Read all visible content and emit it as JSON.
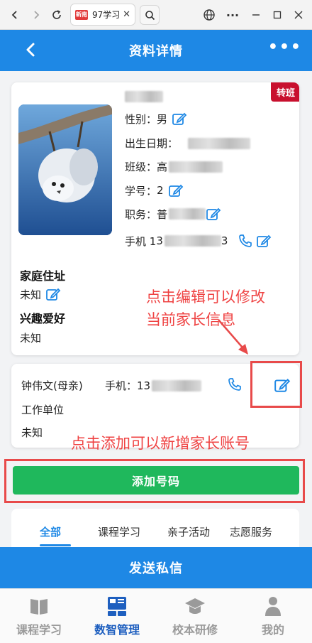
{
  "browser": {
    "tab_title": "97学习",
    "tab_favicon": "新南"
  },
  "header": {
    "title": "资料详情"
  },
  "profile": {
    "badge": "转班",
    "gender_label": "性别：",
    "gender_value": "男",
    "birthday_label": "出生日期：",
    "class_label": "班级：",
    "class_value_prefix": "高",
    "student_no_label": "学号：",
    "student_no_prefix": "2",
    "position_label": "职务：",
    "position_prefix": "普",
    "phone_label": "手机 1",
    "phone_prefix": "3",
    "phone_suffix": "3",
    "address_title": "家庭住址",
    "address_value": "未知",
    "hobby_title": "兴趣爱好",
    "hobby_value": "未知"
  },
  "parent": {
    "name": "钟伟文(母亲)",
    "phone_label": "手机：",
    "phone_prefix": "13",
    "work_title": "工作单位",
    "work_value": "未知"
  },
  "annotations": {
    "edit_hint_line1": "点击编辑可以修改",
    "edit_hint_line2": "当前家长信息",
    "add_hint": "点击添加可以新增家长账号"
  },
  "add_button": "添加号码",
  "tabs": [
    "全部",
    "课程学习",
    "亲子活动",
    "志愿服务"
  ],
  "send_button": "发送私信",
  "bottom_nav": [
    {
      "label": "课程学习",
      "icon": "book-icon"
    },
    {
      "label": "数智管理",
      "icon": "dashboard-icon"
    },
    {
      "label": "校本研修",
      "icon": "graduation-cap-icon"
    },
    {
      "label": "我的",
      "icon": "person-icon"
    }
  ],
  "colors": {
    "primary": "#1e88e5",
    "green": "#1fb85c",
    "badge_red": "#c8102e",
    "annotation_red": "#ef4343"
  }
}
